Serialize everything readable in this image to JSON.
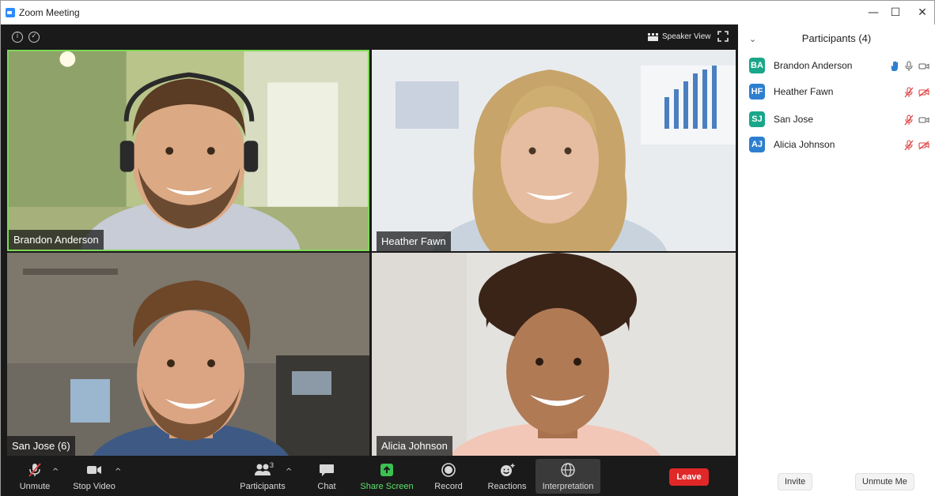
{
  "window": {
    "title": "Zoom Meeting",
    "minimize_glyph": "—",
    "maximize_glyph": "☐",
    "close_glyph": "✕"
  },
  "meeting": {
    "speaker_view_label": "Speaker View",
    "tiles": [
      {
        "name": "Brandon Anderson",
        "active_speaker": true
      },
      {
        "name": "Heather Fawn"
      },
      {
        "name": "San Jose (6)"
      },
      {
        "name": "Alicia Johnson"
      }
    ]
  },
  "toolbar": {
    "unmute_label": "Unmute",
    "stop_video_label": "Stop Video",
    "participants_label": "Participants",
    "participants_count": "3",
    "chat_label": "Chat",
    "share_screen_label": "Share Screen",
    "record_label": "Record",
    "reactions_label": "Reactions",
    "interpretation_label": "Interpretation",
    "leave_label": "Leave"
  },
  "panel": {
    "title": "Participants (4)",
    "participants": [
      {
        "initials": "BA",
        "name": "Brandon Anderson",
        "color": "#1aa68a",
        "hand_raised": true,
        "muted": false,
        "video_off": false
      },
      {
        "initials": "HF",
        "name": "Heather Fawn",
        "color": "#2d7fd0",
        "hand_raised": false,
        "muted": true,
        "video_off": true
      },
      {
        "initials": "SJ",
        "name": "San Jose",
        "color": "#1aa68a",
        "hand_raised": false,
        "muted": true,
        "video_off": false
      },
      {
        "initials": "AJ",
        "name": "Alicia Johnson",
        "color": "#2d7fd0",
        "hand_raised": false,
        "muted": true,
        "video_off": true
      }
    ],
    "invite_label": "Invite",
    "unmute_me_label": "Unmute Me"
  },
  "colors": {
    "active_speaker_border": "#7ed957",
    "share_screen": "#5ce16a",
    "leave": "#e02828",
    "muted_icon": "#e04040",
    "hand_icon": "#2d7fd0"
  }
}
